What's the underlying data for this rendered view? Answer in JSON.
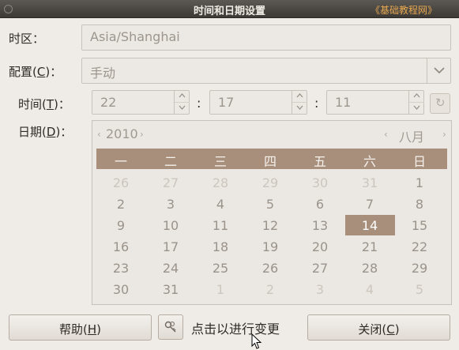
{
  "window": {
    "title": "时间和日期设置",
    "watermark": "《基础教程网》"
  },
  "timezone": {
    "label": "时区：",
    "value": "Asia/Shanghai"
  },
  "config": {
    "label_text": "配置",
    "label_mnemonic": "C",
    "value": "手动"
  },
  "time": {
    "label_text": "时间",
    "label_mnemonic": "T",
    "hours": "22",
    "minutes": "17",
    "seconds": "11",
    "separator": ":"
  },
  "date": {
    "label_text": "日期",
    "label_mnemonic": "D",
    "year": "2010",
    "month": "八月",
    "weekdays": [
      "一",
      "二",
      "三",
      "四",
      "五",
      "六",
      "日"
    ],
    "weeks": [
      [
        "26",
        "27",
        "28",
        "29",
        "30",
        "31",
        "1"
      ],
      [
        "2",
        "3",
        "4",
        "5",
        "6",
        "7",
        "8"
      ],
      [
        "9",
        "10",
        "11",
        "12",
        "13",
        "14",
        "15"
      ],
      [
        "16",
        "17",
        "18",
        "19",
        "20",
        "21",
        "22"
      ],
      [
        "23",
        "24",
        "25",
        "26",
        "27",
        "28",
        "29"
      ],
      [
        "30",
        "31",
        "1",
        "2",
        "3",
        "4",
        "5"
      ]
    ],
    "selected_day": "14"
  },
  "buttons": {
    "help_text": "帮助",
    "help_mnemonic": "H",
    "unlock_text": "点击以进行变更",
    "close_text": "关闭",
    "close_mnemonic": "C"
  },
  "colors": {
    "accent": "#a88f7c",
    "background": "#efebe7",
    "titlebar": "#3d3a36"
  },
  "icons": {
    "year_prev": "chevron-left",
    "year_next": "chevron-right",
    "month_prev": "chevron-left",
    "month_next": "chevron-right",
    "lock": "key-lock",
    "refresh": "refresh"
  }
}
